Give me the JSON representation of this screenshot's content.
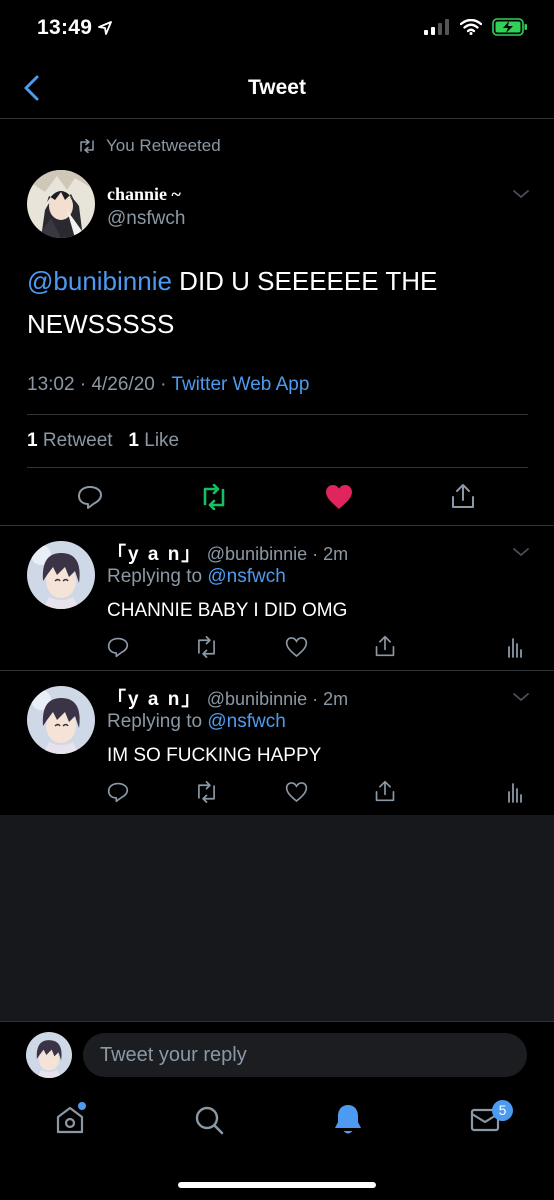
{
  "status_bar": {
    "time": "13:49"
  },
  "header": {
    "title": "Tweet"
  },
  "retweet_context": {
    "label": "You Retweeted"
  },
  "main_tweet": {
    "name": "channie ~",
    "handle": "@nsfwch",
    "mention": "@bunibinnie",
    "text": " DID U SEEEEEE THE NEWSSSSS",
    "time": "13:02",
    "date": "4/26/20",
    "source": "Twitter Web App",
    "retweet_count": "1",
    "retweet_label": "Retweet",
    "like_count": "1",
    "like_label": "Like"
  },
  "replies": [
    {
      "name": "「y a n」",
      "handle": "@bunibinnie",
      "age": "2m",
      "replying_prefix": "Replying to ",
      "replying_to": "@nsfwch",
      "text": "CHANNIE BABY I DID OMG"
    },
    {
      "name": "「y a n」",
      "handle": "@bunibinnie",
      "age": "2m",
      "replying_prefix": "Replying to ",
      "replying_to": "@nsfwch",
      "text": "IM SO FUCKING HAPPY"
    }
  ],
  "composer": {
    "placeholder": "Tweet your reply"
  },
  "tabbar": {
    "messages_badge": "5"
  },
  "colors": {
    "accent": "#4d9bf0",
    "retweet_green": "#17bf63",
    "like_red": "#e0245e",
    "secondary_text": "#8b98a5"
  }
}
